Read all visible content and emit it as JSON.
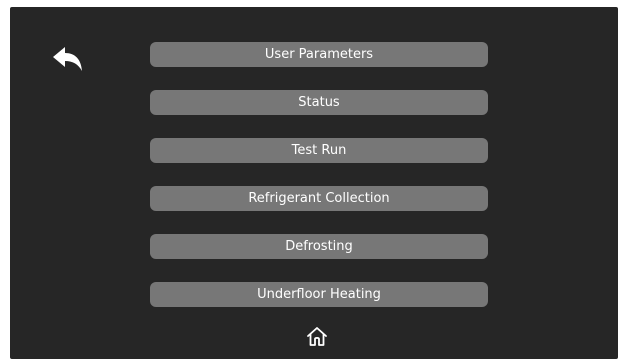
{
  "colors": {
    "screen_background": "#262626",
    "button_background": "#777777",
    "text": "#ffffff",
    "icon": "#ffffff"
  },
  "icons": {
    "back": "back-arrow-icon",
    "home": "home-icon"
  },
  "menu": {
    "items": [
      {
        "label": "User Parameters"
      },
      {
        "label": "Status"
      },
      {
        "label": "Test Run"
      },
      {
        "label": "Refrigerant Collection"
      },
      {
        "label": "Defrosting"
      },
      {
        "label": "Underfloor Heating"
      }
    ]
  }
}
